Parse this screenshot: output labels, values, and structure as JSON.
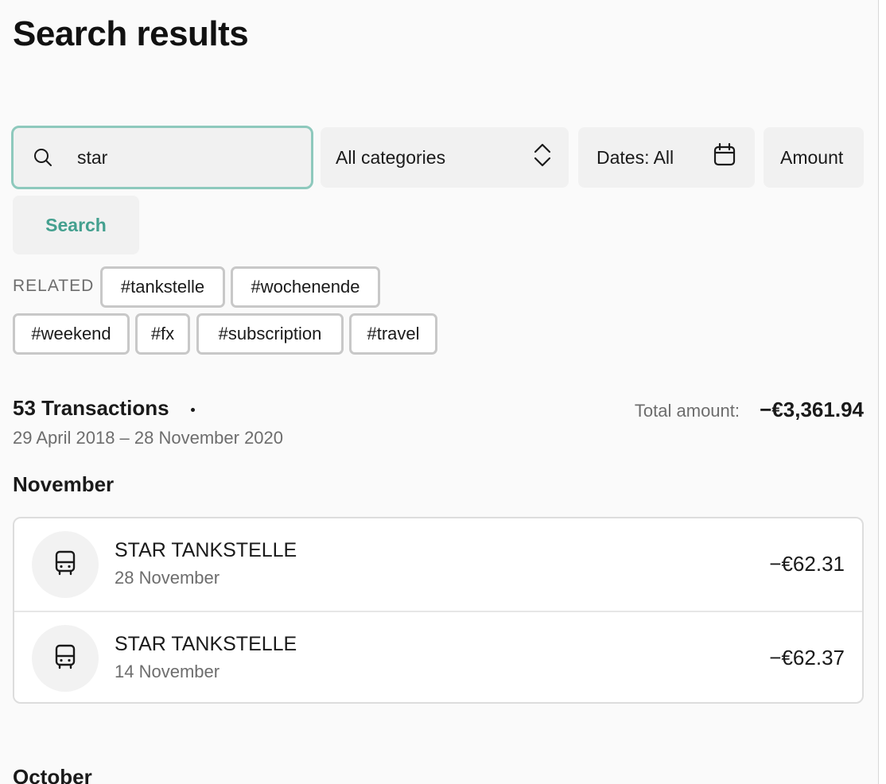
{
  "page": {
    "title": "Search results"
  },
  "search": {
    "value": "star",
    "button_label": "Search"
  },
  "filters": {
    "categories": "All categories",
    "dates": "Dates: All",
    "amount": "Amount"
  },
  "related": {
    "label": "RELATED",
    "tags": [
      "#tankstelle",
      "#wochenende",
      "#weekend",
      "#fx",
      "#subscription",
      "#travel"
    ]
  },
  "summary": {
    "count": "53 Transactions",
    "range": "29 April 2018 – 28 November 2020",
    "total_label": "Total amount:",
    "total_value": "−€3,361.94"
  },
  "groups": [
    {
      "month": "November",
      "transactions": [
        {
          "name": "STAR TANKSTELLE",
          "date": "28 November",
          "amount": "−€62.31",
          "icon": "bus-icon"
        },
        {
          "name": "STAR TANKSTELLE",
          "date": "14 November",
          "amount": "−€62.37",
          "icon": "bus-icon"
        }
      ]
    },
    {
      "month": "October",
      "transactions": []
    }
  ],
  "colors": {
    "accent": "#44a08f",
    "focus_border": "#8ec9bd",
    "muted_text": "#6d6d6d"
  }
}
